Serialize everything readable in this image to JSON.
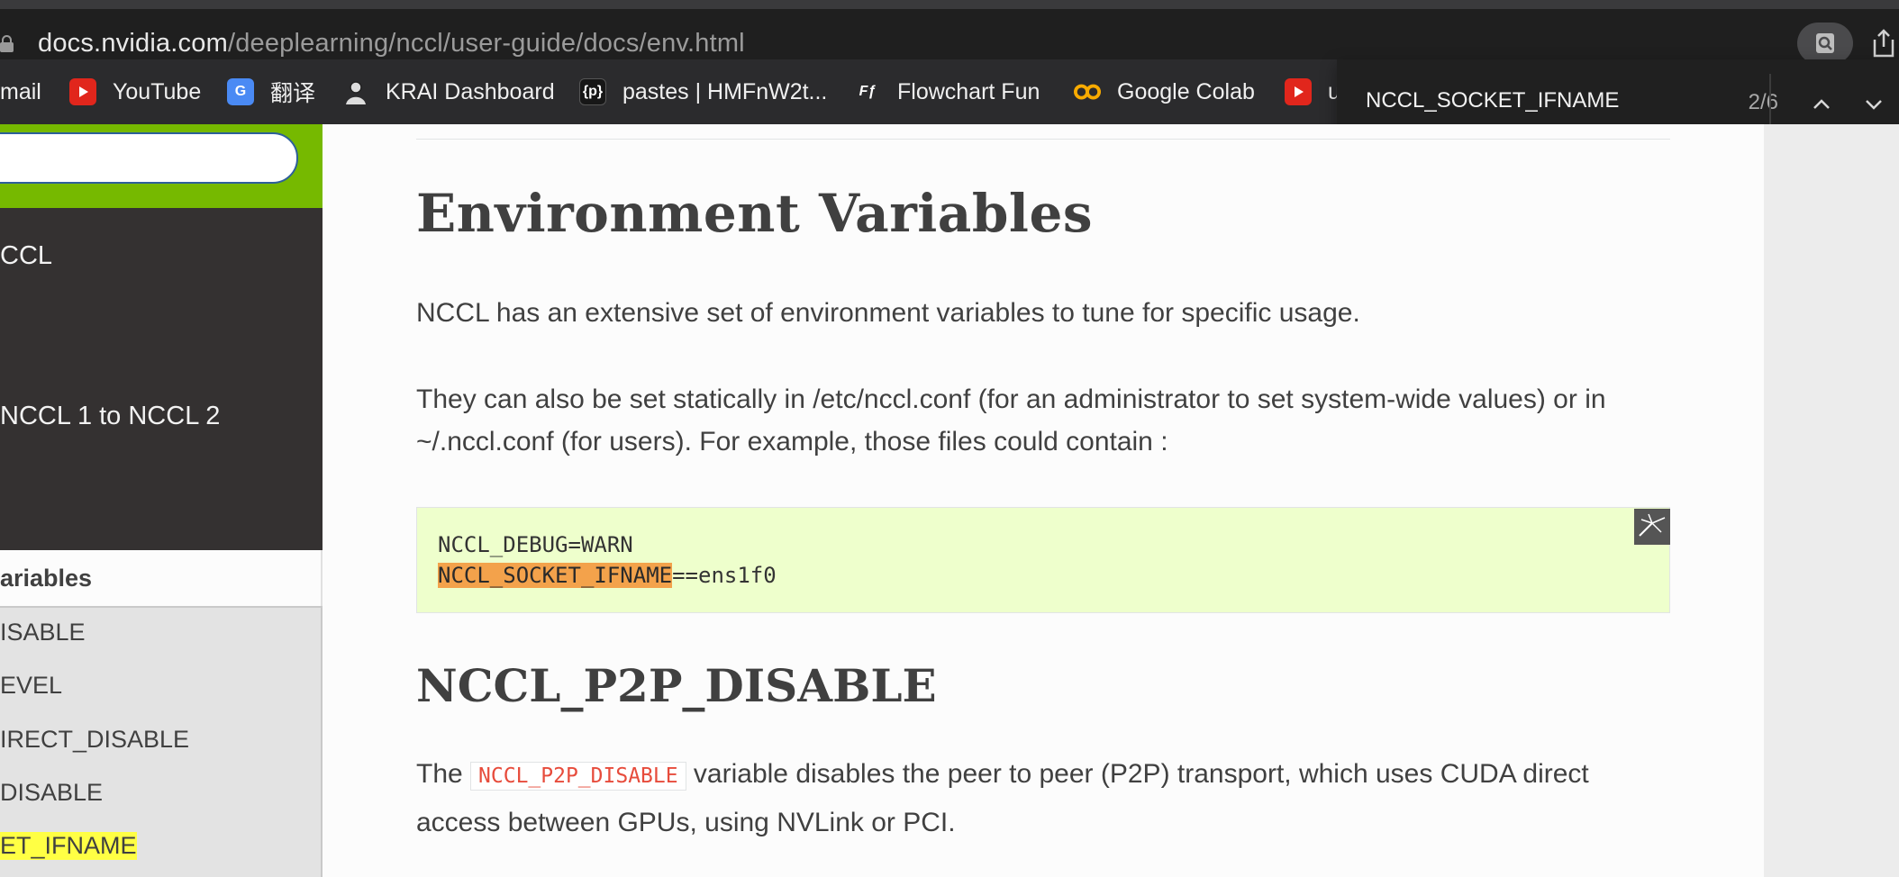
{
  "browser": {
    "url_host": "docs.nvidia.com",
    "url_path": "/deeplearning/nccl/user-guide/docs/env.html"
  },
  "bookmarks": [
    {
      "label": "mail",
      "icon": "mail-icon"
    },
    {
      "label": "YouTube",
      "icon": "youtube-icon"
    },
    {
      "label": "翻译",
      "icon": "google-translate-icon",
      "icon_text": "G"
    },
    {
      "label": "KRAI Dashboard",
      "icon": "krai-avatar-icon"
    },
    {
      "label": "pastes | HMFnW2t...",
      "icon": "pastes-icon",
      "icon_text": "{p}"
    },
    {
      "label": "Flowchart Fun",
      "icon": "flowchart-fun-icon",
      "icon_text": "Fƒ"
    },
    {
      "label": "Google Colab",
      "icon": "google-colab-icon",
      "icon_text": "CO"
    },
    {
      "label": "u",
      "icon": "youtube-icon"
    }
  ],
  "find": {
    "query": "NCCL_SOCKET_IFNAME",
    "count": "2/6"
  },
  "sidebar": {
    "top_items": [
      "CCL",
      "NCCL 1 to NCCL 2"
    ],
    "current": "ariables",
    "sub_items": [
      "ISABLE",
      "EVEL",
      "IRECT_DISABLE",
      "DISABLE",
      "ET_IFNAME"
    ]
  },
  "content": {
    "title": "Environment Variables",
    "intro": "NCCL has an extensive set of environment variables to tune for specific usage.",
    "static_conf": "They can also be set statically in /etc/nccl.conf (for an administrator to set system-wide values) or in ~/.nccl.conf (for users). For example, those files could contain :",
    "code": {
      "line1": "NCCL_DEBUG=WARN",
      "line2_match": "NCCL_SOCKET_IFNAME",
      "line2_rest": "==ens1f0"
    },
    "section_title": "NCCL_P2P_DISABLE",
    "section_text_before": "The ",
    "section_code": "NCCL_P2P_DISABLE",
    "section_text_after": " variable disables the peer to peer (P2P) transport, which uses CUDA direct access between GPUs, using NVLink or PCI."
  },
  "colors": {
    "nvidia_green": "#76b900",
    "code_bg": "#eeffcc",
    "find_match": "#f3a24b",
    "sidebar_highlight": "#ffff44"
  }
}
